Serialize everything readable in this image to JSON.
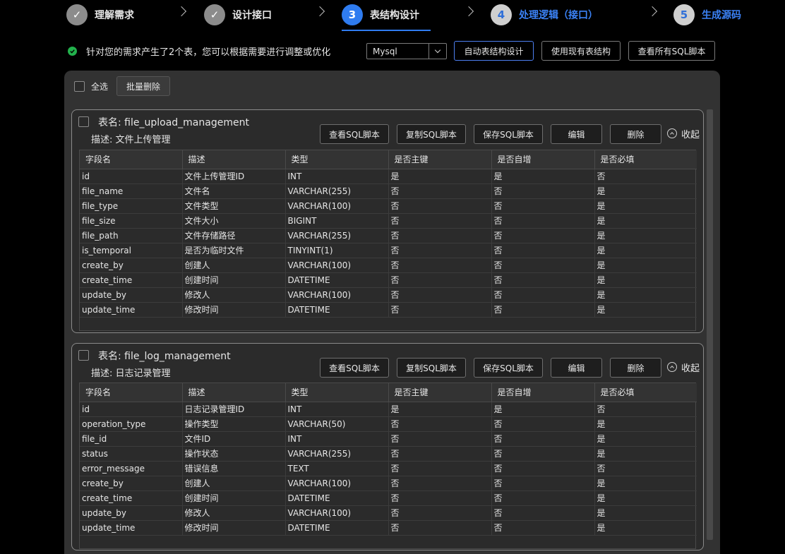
{
  "steps": [
    {
      "label": "理解需求",
      "state": "done",
      "mark": "✓"
    },
    {
      "label": "设计接口",
      "state": "done",
      "mark": "✓"
    },
    {
      "label": "表结构设计",
      "state": "active",
      "mark": "3"
    },
    {
      "label": "处理逻辑（接口）",
      "state": "pending",
      "mark": "4"
    },
    {
      "label": "生成源码",
      "state": "pending",
      "mark": "5"
    }
  ],
  "info": {
    "message": "针对您的需求产生了2个表，您可以根据需要进行调整或优化",
    "db_select": "Mysql",
    "buttons": {
      "auto": "自动表结构设计",
      "existing": "使用现有表结构",
      "view_all": "查看所有SQL脚本"
    }
  },
  "panel": {
    "select_all": "全选",
    "batch_delete": "批量删除"
  },
  "card_labels": {
    "view_sql": "查看SQL脚本",
    "copy_sql": "复制SQL脚本",
    "save_sql": "保存SQL脚本",
    "edit": "编辑",
    "delete": "删除",
    "collapse": "收起"
  },
  "columns": [
    "字段名",
    "描述",
    "类型",
    "是否主键",
    "是否自增",
    "是否必填"
  ],
  "tables": [
    {
      "title": "表名: file_upload_management",
      "desc": "描述: 文件上传管理",
      "rows": [
        [
          "id",
          "文件上传管理ID",
          "INT",
          "是",
          "是",
          "否"
        ],
        [
          "file_name",
          "文件名",
          "VARCHAR(255)",
          "否",
          "否",
          "是"
        ],
        [
          "file_type",
          "文件类型",
          "VARCHAR(100)",
          "否",
          "否",
          "是"
        ],
        [
          "file_size",
          "文件大小",
          "BIGINT",
          "否",
          "否",
          "是"
        ],
        [
          "file_path",
          "文件存储路径",
          "VARCHAR(255)",
          "否",
          "否",
          "是"
        ],
        [
          "is_temporal",
          "是否为临时文件",
          "TINYINT(1)",
          "否",
          "否",
          "是"
        ],
        [
          "create_by",
          "创建人",
          "VARCHAR(100)",
          "否",
          "否",
          "是"
        ],
        [
          "create_time",
          "创建时间",
          "DATETIME",
          "否",
          "否",
          "是"
        ],
        [
          "update_by",
          "修改人",
          "VARCHAR(100)",
          "否",
          "否",
          "是"
        ],
        [
          "update_time",
          "修改时间",
          "DATETIME",
          "否",
          "否",
          "是"
        ]
      ]
    },
    {
      "title": "表名: file_log_management",
      "desc": "描述: 日志记录管理",
      "rows": [
        [
          "id",
          "日志记录管理ID",
          "INT",
          "是",
          "是",
          "否"
        ],
        [
          "operation_type",
          "操作类型",
          "VARCHAR(50)",
          "否",
          "否",
          "是"
        ],
        [
          "file_id",
          "文件ID",
          "INT",
          "否",
          "否",
          "是"
        ],
        [
          "status",
          "操作状态",
          "VARCHAR(255)",
          "否",
          "否",
          "是"
        ],
        [
          "error_message",
          "错误信息",
          "TEXT",
          "否",
          "否",
          "否"
        ],
        [
          "create_by",
          "创建人",
          "VARCHAR(100)",
          "否",
          "否",
          "是"
        ],
        [
          "create_time",
          "创建时间",
          "DATETIME",
          "否",
          "否",
          "是"
        ],
        [
          "update_by",
          "修改人",
          "VARCHAR(100)",
          "否",
          "否",
          "是"
        ],
        [
          "update_time",
          "修改时间",
          "DATETIME",
          "否",
          "否",
          "是"
        ]
      ]
    }
  ]
}
